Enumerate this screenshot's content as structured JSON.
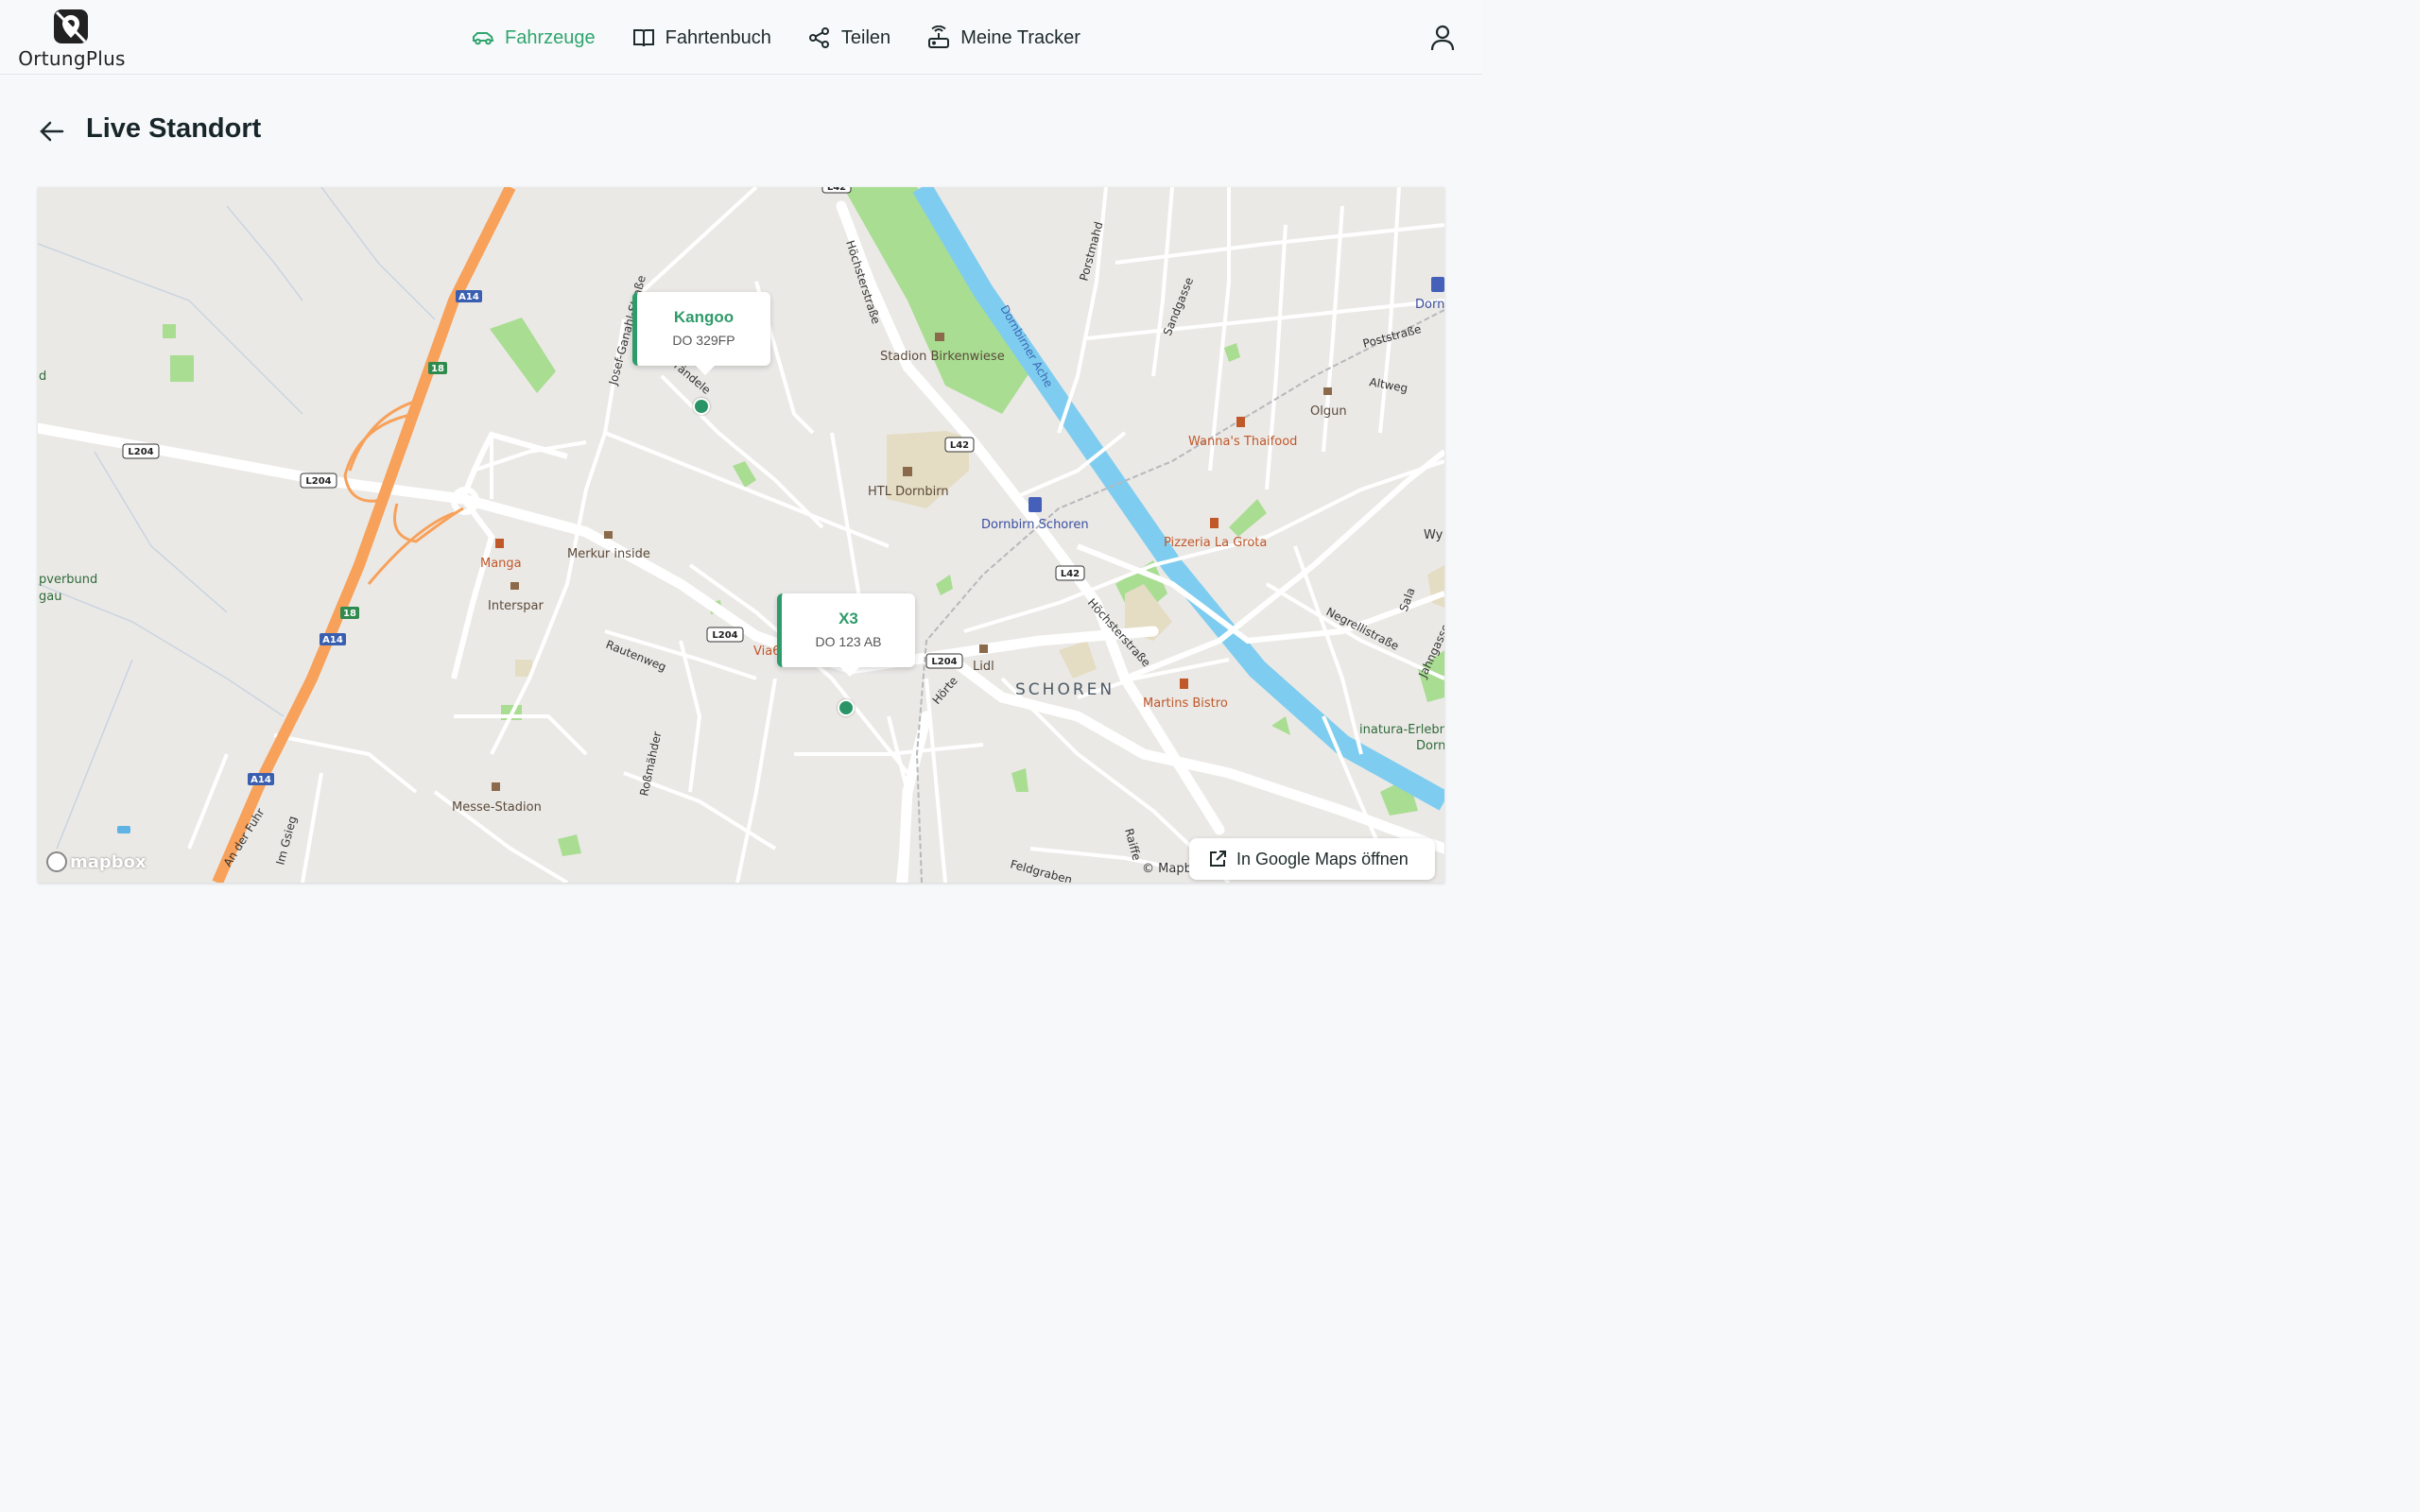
{
  "app": {
    "logo_text": "OrtungPlus"
  },
  "nav": {
    "items": [
      {
        "label": "Fahrzeuge",
        "icon": "car-icon",
        "active": true
      },
      {
        "label": "Fahrtenbuch",
        "icon": "book-icon",
        "active": false
      },
      {
        "label": "Teilen",
        "icon": "share-icon",
        "active": false
      },
      {
        "label": "Meine Tracker",
        "icon": "tracker-icon",
        "active": false
      }
    ]
  },
  "page": {
    "title": "Live Standort"
  },
  "vehicles": [
    {
      "name": "Kangoo",
      "plate": "DO 329FP"
    },
    {
      "name": "X3",
      "plate": "DO 123 AB"
    }
  ],
  "map": {
    "google_maps_label": "In Google Maps öffnen",
    "provider": "mapbox",
    "attribution": "© Mapbo",
    "road_labels": [
      "A14",
      "18",
      "L204",
      "L42",
      "Höchsterstraße",
      "Dornbirner Ache",
      "Josef-Ganahl-Straße",
      "Brändele",
      "Rautenweg",
      "Roßmähder",
      "An der Fuhr",
      "Im Gsieg",
      "Feldgraben",
      "Hörte",
      "Negrellistraße",
      "Poststraße",
      "Altweg",
      "Sandgasse",
      "Porstmahd",
      "Raiffe",
      "Sala",
      "Jahngasse"
    ],
    "poi_labels": [
      "Stadion Birkenwiese",
      "HTL Dornbirn",
      "Dornbirn Schoren",
      "Merkur inside",
      "Manga",
      "Interspar",
      "Messe-Stadion",
      "Lidl",
      "Via6",
      "Wanna's Thaifood",
      "Pizzeria La Grota",
      "Olgun",
      "Martins Bistro",
      "inatura-Erlebn",
      "Dorn",
      "Wy",
      "pverbund",
      "gau",
      "d"
    ],
    "district_label": "SCHOREN"
  },
  "colors": {
    "accent": "#2fa56e",
    "marker": "#2a9466",
    "motorway": "#f7a15a",
    "river": "#7ecdf0",
    "park": "#a9dd92"
  }
}
